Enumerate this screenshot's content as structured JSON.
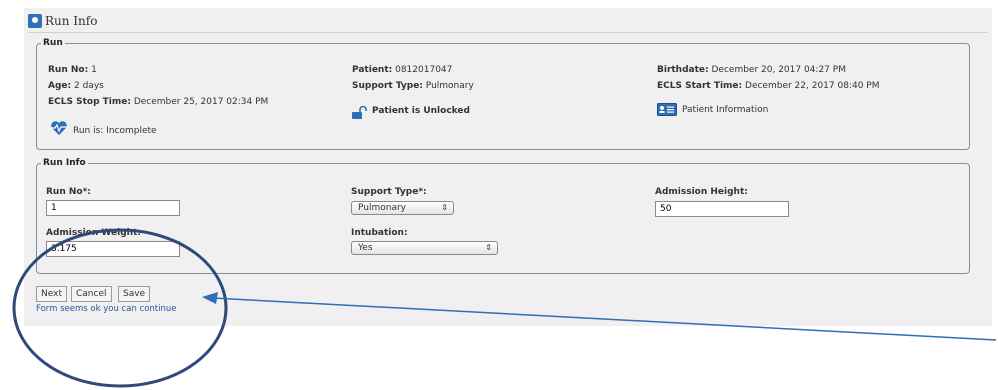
{
  "window": {
    "title": "Run Info"
  },
  "run_section": {
    "legend": "Run",
    "run_no_label": "Run No:",
    "run_no": "1",
    "age_label": "Age:",
    "age": "2 days",
    "ecls_stop_label": "ECLS Stop Time:",
    "ecls_stop": "December 25, 2017 02:34 PM",
    "status_text": "Run is: Incomplete",
    "patient_label": "Patient:",
    "patient": "0812017047",
    "support_type_label": "Support Type:",
    "support_type": "Pulmonary",
    "unlock_text": "Patient is Unlocked",
    "birthdate_label": "Birthdate:",
    "birthdate": "December 20, 2017 04:27 PM",
    "ecls_start_label": "ECLS Start Time:",
    "ecls_start": "December 22, 2017 08:40 PM",
    "patient_info_link": "Patient Information"
  },
  "run_info_form": {
    "legend": "Run Info",
    "run_no_label": "Run No*:",
    "run_no_value": "1",
    "support_type_label": "Support Type*:",
    "support_type_value": "Pulmonary",
    "admission_height_label": "Admission Height:",
    "admission_height_value": "50",
    "admission_weight_label": "Admission Weight:",
    "admission_weight_value": "3.175",
    "intubation_label": "Intubation:",
    "intubation_value": "Yes"
  },
  "actions": {
    "next_label": "Next",
    "cancel_label": "Cancel",
    "save_label": "Save",
    "status_message": "Form seems ok you can continue"
  },
  "annotation": {
    "circle_color": "#2f4a7a",
    "arrow_color": "#2f6fb5"
  }
}
